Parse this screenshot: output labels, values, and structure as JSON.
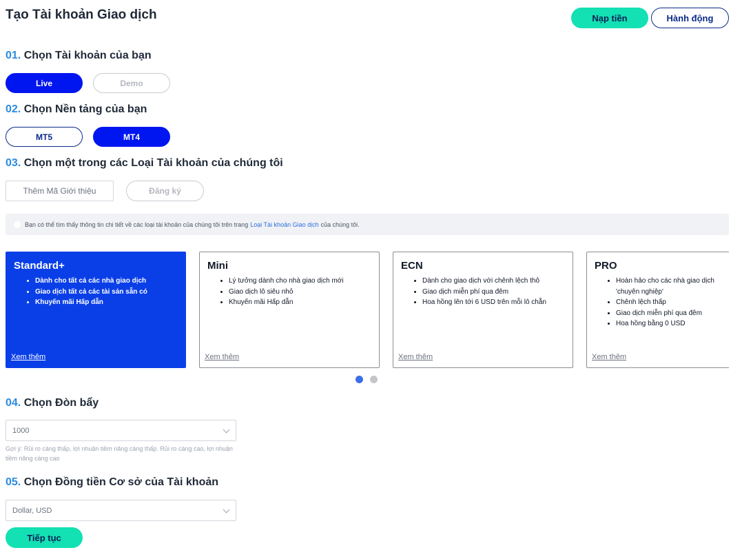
{
  "header": {
    "title": "Tạo Tài khoản Giao dịch",
    "deposit_label": "Nạp tiền",
    "action_label": "Hành động"
  },
  "steps": {
    "account": {
      "num": "01.",
      "label": "Chọn Tài khoản của bạn",
      "options": [
        "Live",
        "Demo"
      ],
      "selected": "Live"
    },
    "platform": {
      "num": "02.",
      "label": "Chọn Nền tảng của bạn",
      "options": [
        "MT5",
        "MT4"
      ],
      "selected": "MT4"
    },
    "account_type": {
      "num": "03.",
      "label": "Chọn một trong các Loại Tài khoản của chúng tôi"
    },
    "leverage": {
      "num": "04.",
      "label": "Chọn Đòn bẩy"
    },
    "currency": {
      "num": "05.",
      "label": "Chọn Đồng tiền Cơ sở của Tài khoản"
    }
  },
  "referral": {
    "placeholder": "Thêm Mã Giới thiệu",
    "register_label": "Đăng ký"
  },
  "info": {
    "text_before": "Bạn có thể tìm thấy thông tin chi tiết về các loại tài khoản của chúng tôi trên trang",
    "link": "Loại Tài khoản Giao dịch",
    "text_after": "của chúng tôi."
  },
  "cards": [
    {
      "title": "Standard+",
      "features": [
        "Dành cho tất cả các nhà giao dịch",
        "Giao dịch tất cả các tài sản sẵn có",
        "Khuyến mãi Hấp dẫn"
      ],
      "more": "Xem thêm",
      "selected": true
    },
    {
      "title": "Mini",
      "features": [
        "Lý tưởng dành cho nhà giao dịch mới",
        "Giao dịch lô siêu nhỏ",
        "Khuyến mãi Hấp dẫn"
      ],
      "more": "Xem thêm",
      "selected": false
    },
    {
      "title": "ECN",
      "features": [
        "Dành cho giao dịch với chênh lệch thô",
        "Giao dịch miễn phí qua đêm",
        "Hoa hồng lên tới 6 USD trên mỗi lô chẵn"
      ],
      "more": "Xem thêm",
      "selected": false
    },
    {
      "title": "PRO",
      "features": [
        "Hoàn hảo cho các nhà giao dịch 'chuyên nghiệp'",
        "Chênh lệch thấp",
        "Giao dịch miễn phí qua đêm",
        "Hoa hồng bằng 0 USD"
      ],
      "more": "Xem thêm",
      "selected": false
    }
  ],
  "carousel": {
    "pages": 2,
    "active": 0
  },
  "leverage": {
    "value": "1000",
    "hint": "Gợi ý: Rủi ro càng thấp, lợi nhuận tiềm năng càng thấp. Rủi ro càng cao, lợi nhuận tiềm năng càng cao"
  },
  "currency": {
    "value": "Dollar, USD"
  },
  "continue_label": "Tiếp tục",
  "colors": {
    "accent_green": "#13e0b3",
    "primary_blue": "#0016f0",
    "card_blue": "#0a3fe8",
    "step_num": "#2b8be0"
  }
}
